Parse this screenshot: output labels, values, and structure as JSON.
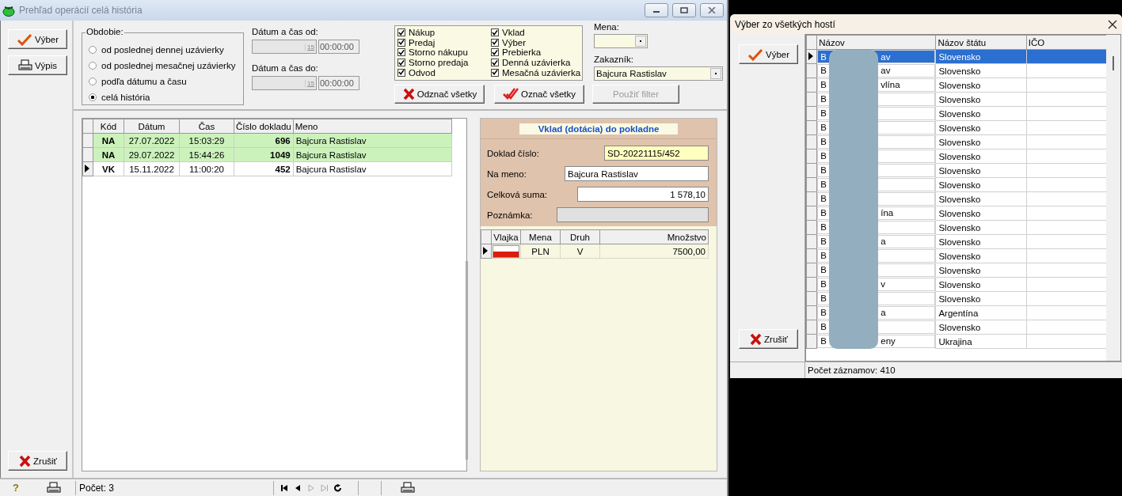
{
  "main_window": {
    "title": "Prehľad operácií celá história"
  },
  "side_buttons": [
    {
      "label": "Výber"
    },
    {
      "label": "Výpis"
    }
  ],
  "cancel_button": {
    "label": "Zrušiť"
  },
  "period": {
    "title": "Obdobie:",
    "options": [
      {
        "label": "od poslednej dennej uzávierky",
        "selected": false
      },
      {
        "label": "od poslednej mesačnej uzávierky",
        "selected": false
      },
      {
        "label": "podľa dátumu a času",
        "selected": false
      },
      {
        "label": "celá história",
        "selected": true
      }
    ]
  },
  "date_from": {
    "label": "Dátum a čas od:",
    "calendar": "15",
    "time": "00:00:00",
    "disabled": true
  },
  "date_to": {
    "label": "Dátum a čas do:",
    "calendar": "15",
    "time": "00:00:00",
    "disabled": true
  },
  "types": [
    {
      "label": "Nákup",
      "checked": true
    },
    {
      "label": "Predaj",
      "checked": true
    },
    {
      "label": "Storno nákupu",
      "checked": true
    },
    {
      "label": "Storno predaja",
      "checked": true
    },
    {
      "label": "Odvod",
      "checked": true
    },
    {
      "label": "Vklad",
      "checked": true
    },
    {
      "label": "Výber",
      "checked": true
    },
    {
      "label": "Prebierka",
      "checked": true
    },
    {
      "label": "Denná uzávierka",
      "checked": true
    },
    {
      "label": "Mesačná uzávierka",
      "checked": true
    }
  ],
  "filter_buttons": [
    {
      "label": "Odznač všetky",
      "disabled": false
    },
    {
      "label": "Označ všetky",
      "disabled": false
    },
    {
      "label": "Použiť filter",
      "disabled": true
    }
  ],
  "currency_filter": {
    "label": "Mena:"
  },
  "customer_filter": {
    "label": "Zakazník:",
    "value": "Bajcura Rastislav"
  },
  "operations": {
    "columns": [
      "Kód",
      "Dátum",
      "Čas",
      "Číslo dokladu",
      "Meno"
    ],
    "rows": [
      {
        "code": "NA",
        "date": "27.07.2022",
        "time": "15:03:29",
        "number": "696",
        "name": "Bajcura Rastislav",
        "color": "#ccf2bc",
        "selected": false
      },
      {
        "code": "NA",
        "date": "29.07.2022",
        "time": "15:44:26",
        "number": "1049",
        "name": "Bajcura Rastislav",
        "color": "#ccf2bc",
        "selected": false
      },
      {
        "code": "VK",
        "date": "15.11.2022",
        "time": "11:00:20",
        "number": "452",
        "name": "Bajcura Rastislav",
        "color": "#ffffff",
        "selected": true
      }
    ]
  },
  "detail": {
    "title": "Vklad (dotácia) do pokladne",
    "fields": [
      {
        "kind": "code",
        "label": "Doklad číslo:",
        "value": "SD-20221115/452"
      },
      {
        "kind": "text",
        "label": "Na meno:",
        "value": "Bajcura Rastislav"
      },
      {
        "kind": "amount",
        "label": "Celková suma:",
        "value": "1 578,10"
      },
      {
        "kind": "note",
        "label": "Poznámka:"
      }
    ],
    "currencies": {
      "columns": [
        "Vlajka",
        "Mena",
        "Druh",
        "Množstvo"
      ],
      "rows": [
        {
          "currency": "PLN",
          "type": "V",
          "amount": "7500,00",
          "selected": true
        }
      ]
    }
  },
  "status_bar": {
    "help": "?",
    "count": "Počet: 3",
    "nav": [
      {
        "kind": "first",
        "disabled": false
      },
      {
        "kind": "prev",
        "disabled": false
      },
      {
        "kind": "next",
        "disabled": true
      },
      {
        "kind": "last",
        "disabled": true
      },
      {
        "kind": "refresh",
        "disabled": false
      }
    ]
  },
  "guest_dialog": {
    "title": "Výber zo všetkých hostí",
    "select_button": "Výber",
    "cancel_button": "Zrušiť",
    "columns": [
      "Názov",
      "Názov štátu",
      "IČO"
    ],
    "rows": [
      {
        "name_start": "B",
        "name_end": "av",
        "country": "Slovensko",
        "selected": true
      },
      {
        "name_start": "B",
        "name_end": "av",
        "country": "Slovensko",
        "selected": false
      },
      {
        "name_start": "B",
        "name_end": "vlína",
        "country": "Slovensko",
        "selected": false
      },
      {
        "name_start": "B",
        "country": "Slovensko",
        "selected": false
      },
      {
        "name_start": "B",
        "country": "Slovensko",
        "selected": false
      },
      {
        "name_start": "B",
        "country": "Slovensko",
        "selected": false
      },
      {
        "name_start": "B",
        "country": "Slovensko",
        "selected": false
      },
      {
        "name_start": "B",
        "country": "Slovensko",
        "selected": false
      },
      {
        "name_start": "B",
        "country": "Slovensko",
        "selected": false
      },
      {
        "name_start": "B",
        "country": "Slovensko",
        "selected": false
      },
      {
        "name_start": "B",
        "country": "Slovensko",
        "selected": false
      },
      {
        "name_start": "B",
        "name_end": "ína",
        "country": "Slovensko",
        "selected": false
      },
      {
        "name_start": "B",
        "country": "Slovensko",
        "selected": false
      },
      {
        "name_start": "B",
        "name_end": "a",
        "country": "Slovensko",
        "selected": false
      },
      {
        "name_start": "B",
        "country": "Slovensko",
        "selected": false
      },
      {
        "name_start": "B",
        "country": "Slovensko",
        "selected": false
      },
      {
        "name_start": "B",
        "name_end": "v",
        "country": "Slovensko",
        "selected": false
      },
      {
        "name_start": "B",
        "country": "Slovensko",
        "selected": false
      },
      {
        "name_start": "B",
        "name_end": "a",
        "country": "Argentína",
        "selected": false
      },
      {
        "name_start": "B",
        "country": "Slovensko",
        "selected": false
      },
      {
        "name_start": "B",
        "name_end": "eny",
        "country": "Ukrajina",
        "selected": false
      }
    ],
    "status": "Počet záznamov: 410"
  }
}
